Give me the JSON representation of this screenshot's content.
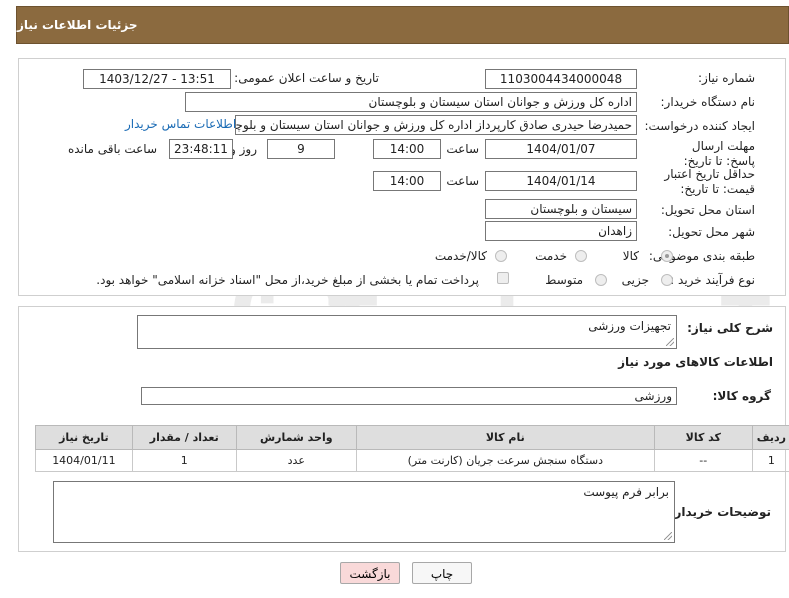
{
  "header": {
    "title": "جزئیات اطلاعات نیاز"
  },
  "form": {
    "need_number_label": "شماره نیاز:",
    "need_number": "1103004434000048",
    "announce_label": "تاریخ و ساعت اعلان عمومی:",
    "announce_value": "1403/12/27 - 13:51",
    "buyer_org_label": "نام دستگاه خریدار:",
    "buyer_org": "اداره کل ورزش و جوانان استان سیستان و بلوچستان",
    "creator_label": "ایجاد کننده درخواست:",
    "creator": "حمیدرضا حیدری صادق کارپرداز اداره کل ورزش و جوانان استان سیستان و بلوچستان",
    "contact_link": "اطلاعات تماس خریدار",
    "deadline_label": "مهلت ارسال پاسخ: تا تاریخ:",
    "deadline_date": "1404/01/07",
    "time_label": "ساعت",
    "deadline_time": "14:00",
    "days_value": "9",
    "days_label": "روز و",
    "remaining_time": "23:48:11",
    "remaining_label": "ساعت باقی مانده",
    "validity_label": "حداقل تاریخ اعتبار قیمت: تا تاریخ:",
    "validity_date": "1404/01/14",
    "validity_time": "14:00",
    "province_label": "استان محل تحویل:",
    "province": "سیستان و بلوچستان",
    "city_label": "شهر محل تحویل:",
    "city": "زاهدان",
    "category_label": "طبقه بندی موضوعی:",
    "category_options": [
      "کالا",
      "خدمت",
      "کالا/خدمت"
    ],
    "process_label": "نوع فرآیند خرید :",
    "process_options": [
      "جزیی",
      "متوسط"
    ],
    "payment_note": "پرداخت تمام یا بخشی از مبلغ خرید،از محل \"اسناد خزانه اسلامی\" خواهد بود."
  },
  "details": {
    "summary_label": "شرح کلی نیاز:",
    "summary_value": "تجهیزات ورزشی",
    "goods_info_title": "اطلاعات کالاهای مورد نیاز",
    "goods_group_label": "گروه کالا:",
    "goods_group_value": "ورزشی",
    "table": {
      "headers": [
        "ردیف",
        "کد کالا",
        "نام کالا",
        "واحد شمارش",
        "تعداد / مقدار",
        "تاریخ نیاز"
      ],
      "rows": [
        [
          "1",
          "--",
          "دستگاه سنجش سرعت جریان (کارنت متر)",
          "عدد",
          "1",
          "1404/01/11"
        ]
      ]
    },
    "buyer_notes_label": "توضیحات خریدار:",
    "buyer_notes_value": "برابر فرم پیوست"
  },
  "buttons": {
    "print": "چاپ",
    "back": "بازگشت"
  },
  "watermark": {
    "text": "AriaTender.neT"
  },
  "colors": {
    "header_bg": "#8b6a3f",
    "link": "#1a6bb5",
    "back_button": "#f9d9d9"
  }
}
